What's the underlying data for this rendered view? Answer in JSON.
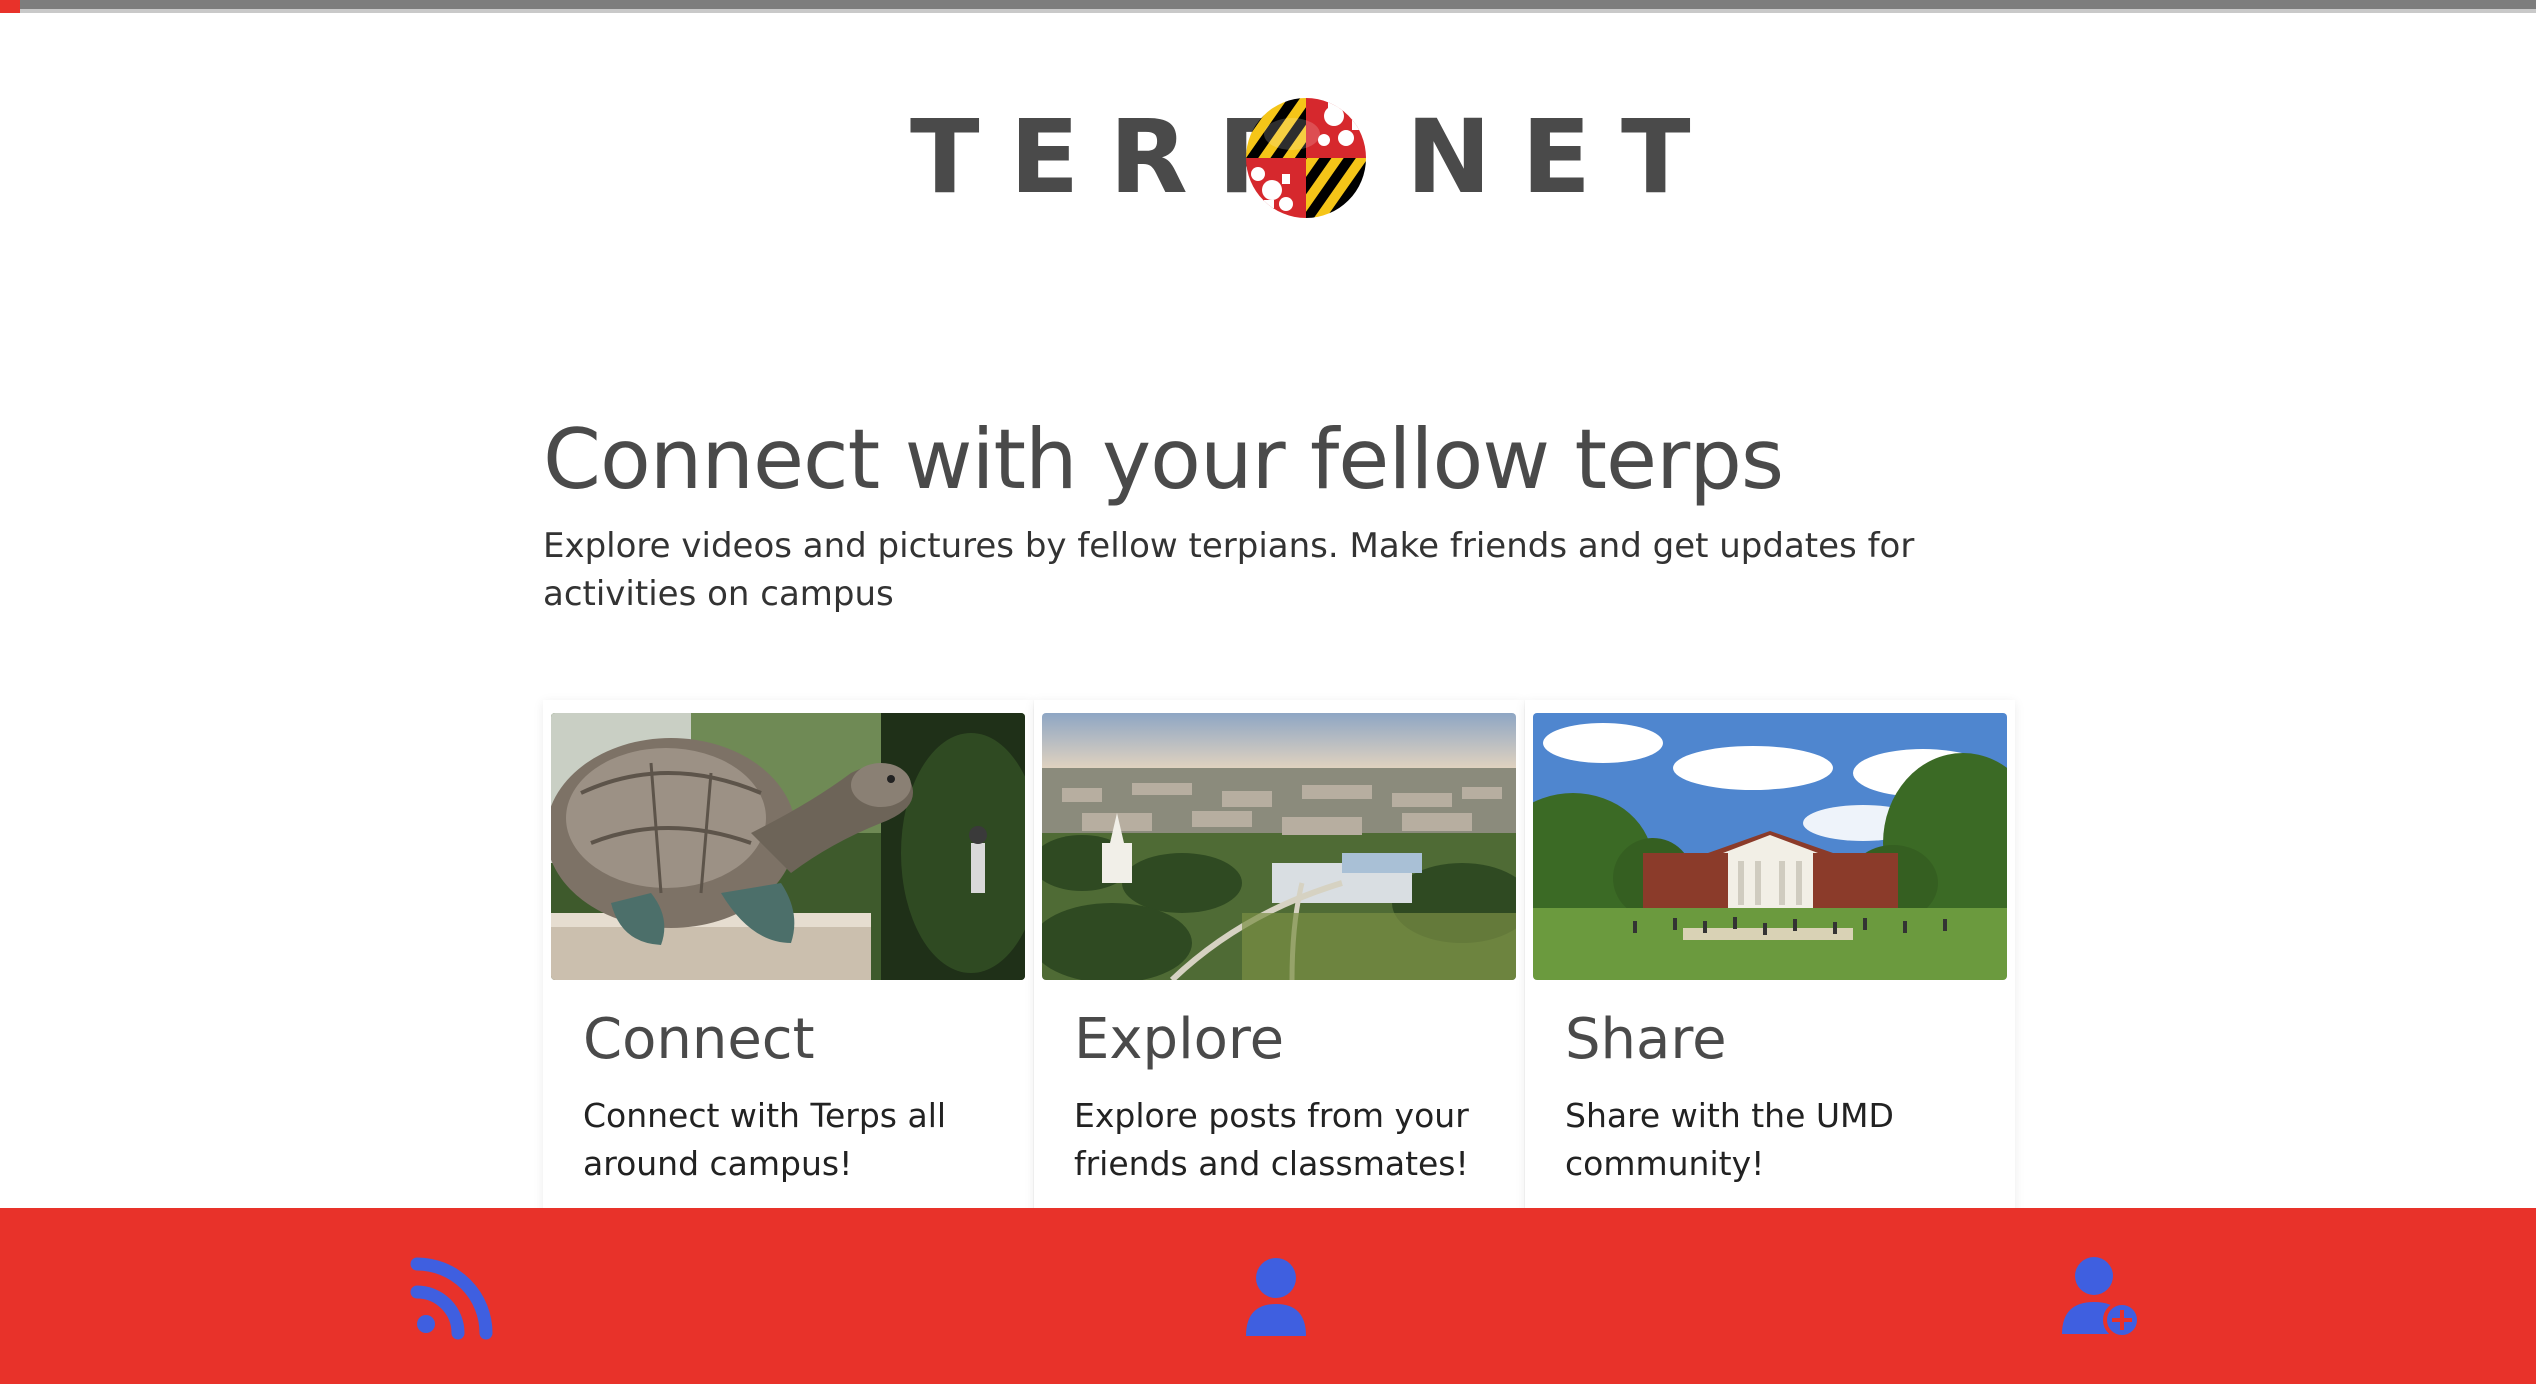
{
  "logo": {
    "left_text": "TERP",
    "right_text": "NET",
    "emblem_icon": "maryland-flag-globe-icon"
  },
  "hero": {
    "title": "Connect with your fellow terps",
    "subtitle": "Explore videos and pictures by fellow terpians. Make friends and get updates for activities on campus"
  },
  "cards": [
    {
      "title": "Connect",
      "text": "Connect with Terps all around campus!",
      "image": "testudo-turtle-statue-photo"
    },
    {
      "title": "Explore",
      "text": "Explore posts from your friends and classmates!",
      "image": "campus-aerial-photo"
    },
    {
      "title": "Share",
      "text": "Share with the UMD community!",
      "image": "mckeldin-mall-photo"
    }
  ],
  "bottom_nav": [
    {
      "icon": "rss-feed-icon"
    },
    {
      "icon": "user-icon"
    },
    {
      "icon": "add-user-icon"
    }
  ],
  "colors": {
    "brand_red": "#e8322a",
    "icon_blue": "#3f5fe0",
    "text_gray": "#4a4a4a",
    "flag_gold": "#f5c518",
    "flag_black": "#000000"
  }
}
